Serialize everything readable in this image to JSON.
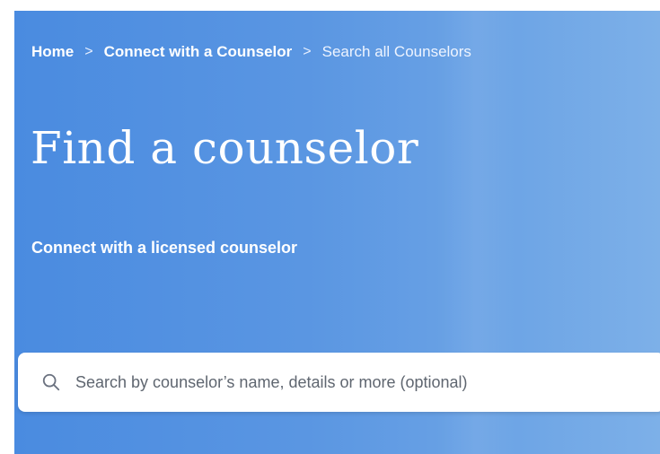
{
  "breadcrumb": {
    "items": [
      {
        "label": "Home"
      },
      {
        "label": "Connect with a Counselor"
      },
      {
        "label": "Search all Counselors"
      }
    ],
    "separator": ">"
  },
  "hero": {
    "title": "Find a counselor",
    "subtitle": "Connect with a licensed counselor",
    "background_color": "#4a8be0"
  },
  "search": {
    "icon": "search-icon",
    "placeholder": "Search by counselor’s name, details or more (optional)",
    "value": ""
  }
}
